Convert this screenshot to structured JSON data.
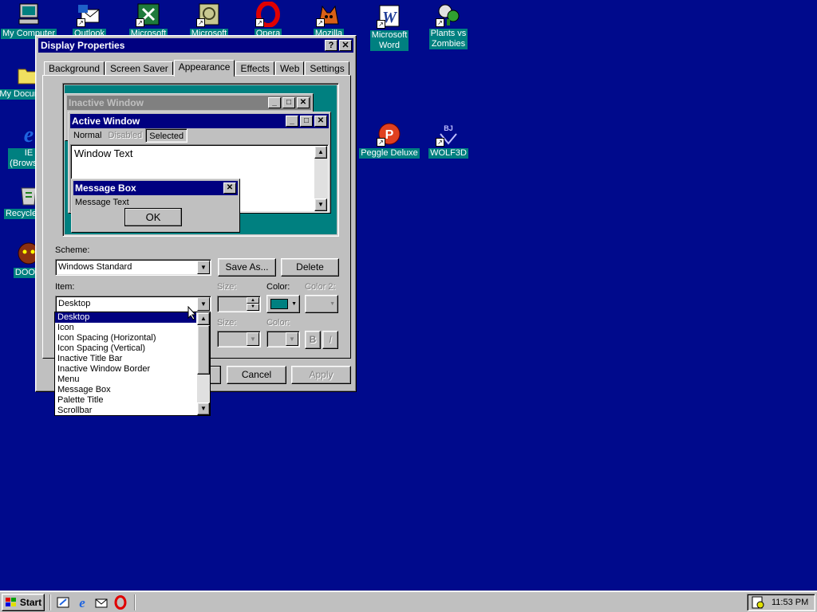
{
  "desktop": {
    "icons": [
      {
        "label": "My Computer"
      },
      {
        "label": "Outlook"
      },
      {
        "label": "Microsoft"
      },
      {
        "label": "Microsoft"
      },
      {
        "label": "Opera"
      },
      {
        "label": "Mozilla"
      },
      {
        "label": "Microsoft\nWord"
      },
      {
        "label": "Plants vs\nZombies"
      },
      {
        "label": "My Documents"
      },
      {
        "label": "IE\n(Browser)"
      },
      {
        "label": "Peggle Deluxe"
      },
      {
        "label": "WOLF3D"
      },
      {
        "label": "Recycle Bin"
      },
      {
        "label": "DOOM"
      }
    ]
  },
  "dialog": {
    "title": "Display Properties",
    "help_btn": "?",
    "close_btn": "✕",
    "tabs": [
      "Background",
      "Screen Saver",
      "Appearance",
      "Effects",
      "Web",
      "Settings"
    ],
    "preview": {
      "inactive_title": "Inactive Window",
      "active_title": "Active Window",
      "menu_normal": "Normal",
      "menu_disabled": "Disabled",
      "menu_selected": "Selected",
      "window_text": "Window Text",
      "msgbox_title": "Message Box",
      "msgbox_text": "Message Text",
      "ok": "OK"
    },
    "scheme_label": "Scheme:",
    "scheme_value": "Windows Standard",
    "save_as": "Save As...",
    "delete": "Delete",
    "item_label": "Item:",
    "item_value": "Desktop",
    "size_label": "Size:",
    "color_label": "Color:",
    "color2_label": "Color 2:",
    "font_size_label": "Size:",
    "font_color_label": "Color:",
    "bold": "B",
    "italic": "I",
    "desktop_color": "#008080",
    "cancel": "Cancel",
    "apply": "Apply",
    "item_options": [
      "Desktop",
      "Icon",
      "Icon Spacing (Horizontal)",
      "Icon Spacing (Vertical)",
      "Inactive Title Bar",
      "Inactive Window Border",
      "Menu",
      "Message Box",
      "Palette Title",
      "Scrollbar"
    ]
  },
  "taskbar": {
    "start": "Start",
    "clock": "11:53 PM"
  },
  "colors": {
    "desktop_bg": "#000a8c",
    "titlebar": "#000080",
    "inactive_title": "#808080",
    "face": "#c0c0c0",
    "teal": "#008080"
  }
}
